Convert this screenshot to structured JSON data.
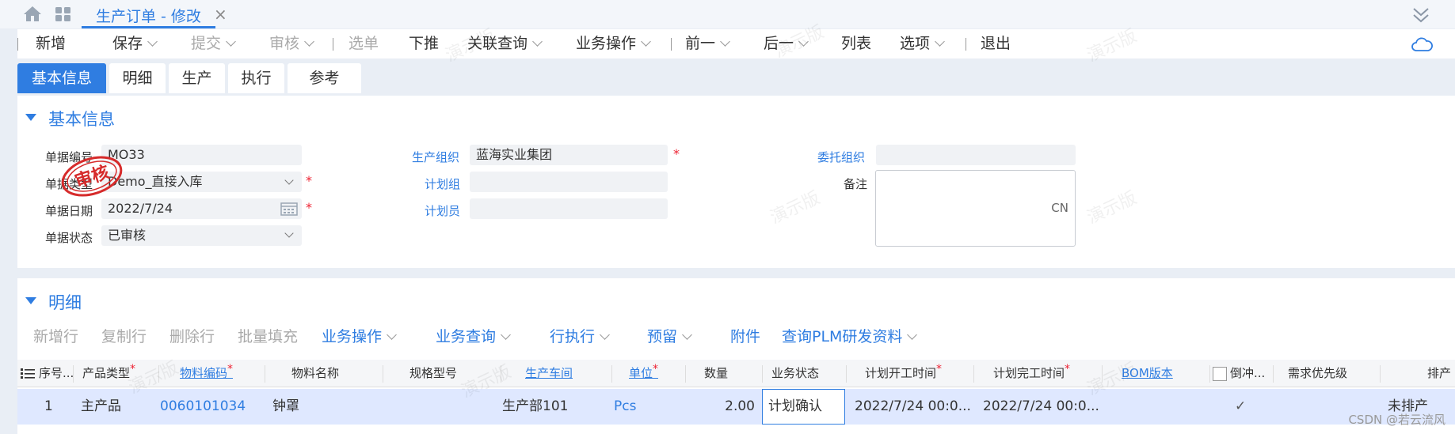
{
  "window": {
    "tab_title": "生产订单 - 修改",
    "tab_close": "×"
  },
  "toolbar": {
    "items": [
      "新增",
      "保存",
      "提交",
      "审核",
      "选单",
      "下推",
      "关联查询",
      "业务操作",
      "前一",
      "后一",
      "列表",
      "选项",
      "退出"
    ]
  },
  "sub_tabs": [
    "基本信息",
    "明细",
    "生产",
    "执行",
    "参考"
  ],
  "basic_info": {
    "title": "基本信息",
    "fields": {
      "bill_no_label": "单据编号",
      "bill_no": "MO33",
      "bill_type_label": "单据类型",
      "bill_type": "Demo_直接入库",
      "bill_date_label": "单据日期",
      "bill_date": "2022/7/24",
      "bill_status_label": "单据状态",
      "bill_status": "已审核",
      "prd_org_label": "生产组织",
      "prd_org": "蓝海实业集团",
      "plan_group_label": "计划组",
      "plan_group": "",
      "planner_label": "计划员",
      "planner": "",
      "entrust_org_label": "委托组织",
      "entrust_org": "",
      "remark_label": "备注",
      "remark_lang": "CN"
    },
    "stamp": "审核"
  },
  "detail": {
    "title": "明细",
    "toolbar": [
      "新增行",
      "复制行",
      "删除行",
      "批量填充",
      "业务操作",
      "业务查询",
      "行执行",
      "预留",
      "附件",
      "查询PLM研发资料"
    ],
    "columns": [
      "序号...",
      "产品类型",
      "物料编码",
      "物料名称",
      "规格型号",
      "生产车间",
      "单位",
      "数量",
      "业务状态",
      "计划开工时间",
      "计划完工时间",
      "BOM版本",
      "倒冲...",
      "需求优先级",
      "排产"
    ],
    "rows": [
      {
        "seq": "1",
        "product_type": "主产品",
        "material_code": "0060101034",
        "material_name": "钟罩",
        "spec": "",
        "workshop": "生产部101",
        "unit": "Pcs",
        "qty": "2.00",
        "biz_status": "计划确认",
        "plan_start": "2022/7/24 00:0...",
        "plan_finish": "2022/7/24 00:0...",
        "bom_version": "",
        "backflush": "✓",
        "priority": "",
        "schedule_status": "未排产"
      }
    ]
  },
  "watermark": "演示版",
  "footer": "CSDN @若云流风",
  "colors": {
    "accent": "#2f7de1",
    "required": "#e23333",
    "stamp": "#d62b2b"
  }
}
